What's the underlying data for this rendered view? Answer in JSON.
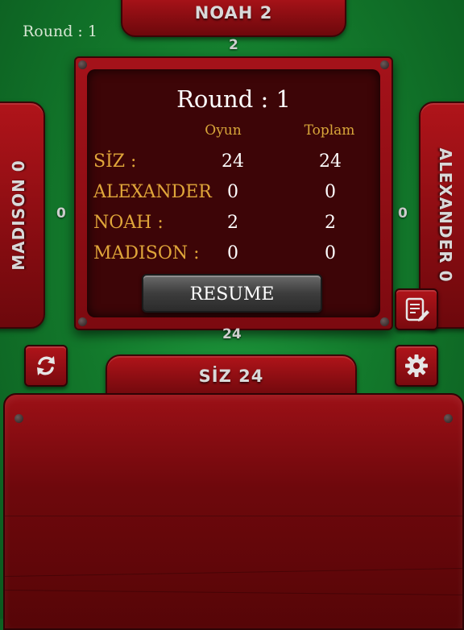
{
  "header": {
    "round_label": "Round : 1"
  },
  "players": {
    "top": {
      "plate": "NOAH 2",
      "score": "2"
    },
    "left": {
      "plate": "MADISON 0",
      "score": "0"
    },
    "right": {
      "plate": "ALEXANDER 0",
      "score": "0"
    },
    "bottom": {
      "plate": "SİZ 24",
      "score": "24"
    }
  },
  "scoreboard": {
    "title": "Round : 1",
    "col_game": "Oyun",
    "col_total": "Toplam",
    "rows": [
      {
        "name": "SİZ :",
        "game": "24",
        "total": "24"
      },
      {
        "name": "ALEXANDER",
        "game": "0",
        "total": "0"
      },
      {
        "name": "NOAH :",
        "game": "2",
        "total": "2"
      },
      {
        "name": "MADISON :",
        "game": "0",
        "total": "0"
      }
    ],
    "resume_label": "RESUME"
  },
  "colors": {
    "felt": "#137a2c",
    "wood": "#8a0d12",
    "gold_text": "#e0a63a"
  }
}
